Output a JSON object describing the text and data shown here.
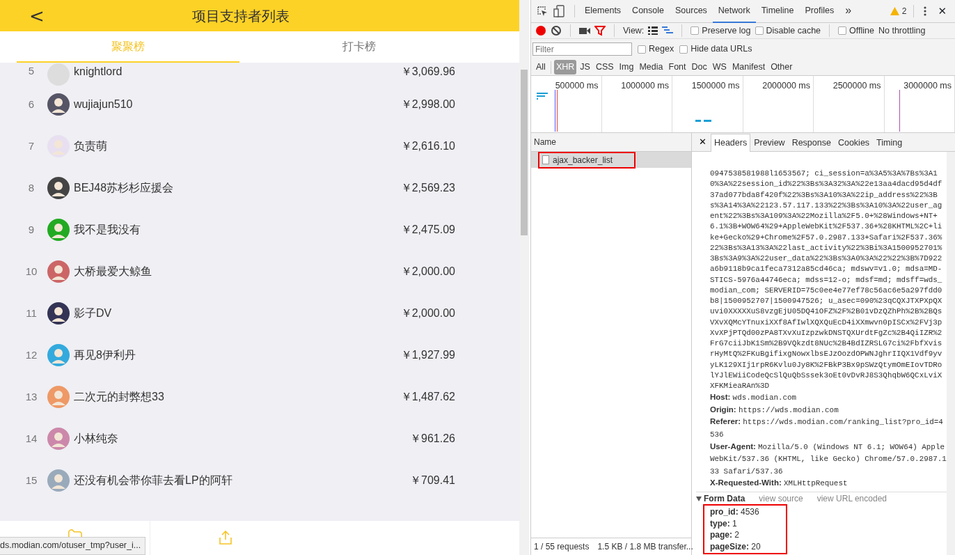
{
  "app": {
    "title": "项目支持者列表",
    "back": "<",
    "tabs": [
      {
        "label": "聚聚榜",
        "selected": true
      },
      {
        "label": "打卡榜",
        "selected": false
      }
    ],
    "backers": [
      {
        "rank": "5",
        "name": "knightlord",
        "amount": "￥3,069.96"
      },
      {
        "rank": "6",
        "name": "wujiajun510",
        "amount": "￥2,998.00"
      },
      {
        "rank": "7",
        "name": "负责萌",
        "amount": "￥2,616.10"
      },
      {
        "rank": "8",
        "name": "BEJ48苏杉杉应援会",
        "amount": "￥2,569.23"
      },
      {
        "rank": "9",
        "name": "我不是我没有",
        "amount": "￥2,475.09"
      },
      {
        "rank": "10",
        "name": "大桥最爱大鲸鱼",
        "amount": "￥2,000.00"
      },
      {
        "rank": "11",
        "name": "影子DV",
        "amount": "￥2,000.00"
      },
      {
        "rank": "12",
        "name": "再见8伊利丹",
        "amount": "￥1,927.99"
      },
      {
        "rank": "13",
        "name": "二次元的封弊想33",
        "amount": "￥1,487.62"
      },
      {
        "rank": "14",
        "name": "小林纯奈",
        "amount": "￥961.26"
      },
      {
        "rank": "15",
        "name": "还没有机会带你菲去看LP的阿轩",
        "amount": "￥709.41"
      }
    ],
    "status_url": "ds.modian.com/otuser_tmp?user_i..."
  },
  "devtools": {
    "panels": [
      {
        "label": "Elements",
        "selected": false
      },
      {
        "label": "Console",
        "selected": false
      },
      {
        "label": "Sources",
        "selected": false
      },
      {
        "label": "Network",
        "selected": true
      },
      {
        "label": "Timeline",
        "selected": false
      },
      {
        "label": "Profiles",
        "selected": false
      }
    ],
    "more": "»",
    "warnings": "2",
    "close": "✕",
    "view_label": "View:",
    "toolbar_checks": [
      {
        "label": "Preserve log",
        "checked": false
      },
      {
        "label": "Disable cache",
        "checked": false
      },
      {
        "label": "Offline",
        "checked": false
      }
    ],
    "throttling": "No throttling",
    "filter": {
      "placeholder": "Filter"
    },
    "filter_checks": [
      {
        "label": "Regex",
        "checked": false
      },
      {
        "label": "Hide data URLs",
        "checked": false
      }
    ],
    "types": [
      {
        "label": "All",
        "selected": false
      },
      {
        "label": "XHR",
        "selected": true
      },
      {
        "label": "JS",
        "selected": false
      },
      {
        "label": "CSS",
        "selected": false
      },
      {
        "label": "Img",
        "selected": false
      },
      {
        "label": "Media",
        "selected": false
      },
      {
        "label": "Font",
        "selected": false
      },
      {
        "label": "Doc",
        "selected": false
      },
      {
        "label": "WS",
        "selected": false
      },
      {
        "label": "Manifest",
        "selected": false
      },
      {
        "label": "Other",
        "selected": false
      }
    ],
    "timeline_ticks": [
      "500000 ms",
      "1000000 ms",
      "1500000 ms",
      "2000000 ms",
      "2500000 ms",
      "3000000 ms"
    ],
    "name_column": "Name",
    "requests": [
      {
        "name": "ajax_backer_list",
        "selected": true,
        "highlighted": true
      }
    ],
    "detail_tabs": [
      {
        "label": "Headers",
        "selected": true
      },
      {
        "label": "Preview",
        "selected": false
      },
      {
        "label": "Response",
        "selected": false
      },
      {
        "label": "Cookies",
        "selected": false
      },
      {
        "label": "Timing",
        "selected": false
      }
    ],
    "cookie_lines": [
      "0947538581988l1653567; ci_session=a%3A5%3A%7Bs%3A1",
      "0%3A%22session_id%22%3Bs%3A32%3A%22e13aa4dacd95d4df",
      "37ad077bda8f420f%22%3Bs%3A10%3A%22ip_address%22%3B",
      "s%3A14%3A%22123.57.117.133%22%3Bs%3A10%3A%22user_ag",
      "ent%22%3Bs%3A109%3A%22Mozilla%2F5.0+%28Windows+NT+",
      "6.1%3B+WOW64%29+AppleWebKit%2F537.36+%28KHTML%2C+li",
      "ke+Gecko%29+Chrome%2F57.0.2987.133+Safari%2F537.36%",
      "22%3Bs%3A13%3A%22last_activity%22%3Bi%3A1500952701%",
      "3Bs%3A9%3A%22user_data%22%3Bs%3A0%3A%22%22%3B%7D922",
      "a6b9118b9ca1feca7312a85cd46ca; mdswv=v1.0; mdsa=MD-",
      "STICS-5976a44746eca; mdss=12-o; mdsf=md; mdsff=wds_",
      "modian_com; SERVERID=75c0ee4e77ef78c56ac6e5a297fdd0",
      "b8|1500952707|1500947526; u_asec=090%23qCQXJTXPXpQX",
      "uvi0XXXXXuS8vzgEjU05DQ41OFZ%2F%2B01vDzQZhPh%2B%2BQs",
      "VXvXQMcYTnuxiXXf8AfIwlXQXQuEcD4iXXmwvn0pISCx%2FVj3p",
      "XvXPjPTQd00zPA8TXvXuIzpzwkDNSTQXUrdtFgZc%2B4QiIZR%2",
      "FrG7ciiJbK1Sm%2B9VQkzdt8NUc%2B4BdIZRSLG7ci%2FbfXvis",
      "rHyMtQ%2FKuBgifixgNowxlbsEJzOozdOPWNJghrIIQX1Vdf9yv",
      "yLK129XIj1rpR6Kvlu0Jy8K%2FBkP3Bx9pSWzQtymOmEIovTDRo",
      "lYJlEWiiCodeQcSlQuQbSssek3oEt0vDvRJ8S3QhqbW6QCxLviX",
      "XFKMieaRAn%3D"
    ],
    "headers": [
      {
        "key": "Host:",
        "value": "wds.modian.com"
      },
      {
        "key": "Origin:",
        "value": "https://wds.modian.com"
      },
      {
        "key": "Referer:",
        "value": "https://wds.modian.com/ranking_list?pro_id=4536"
      },
      {
        "key": "User-Agent:",
        "value": "Mozilla/5.0 (Windows NT 6.1; WOW64) AppleWebKit/537.36 (KHTML, like Gecko) Chrome/57.0.2987.133 Safari/537.36"
      },
      {
        "key": "X-Requested-With:",
        "value": "XMLHttpRequest"
      }
    ],
    "form_data": {
      "title": "Form Data",
      "expanded": true,
      "view_source": "view source",
      "view_encoded": "view URL encoded",
      "highlighted": true,
      "fields": [
        {
          "key": "pro_id:",
          "value": "4536"
        },
        {
          "key": "type:",
          "value": "1"
        },
        {
          "key": "page:",
          "value": "2"
        },
        {
          "key": "pageSize:",
          "value": "20"
        }
      ]
    },
    "summary": [
      "1 / 55 requests",
      "1.5 KB / 1.8 MB transfer..."
    ]
  }
}
